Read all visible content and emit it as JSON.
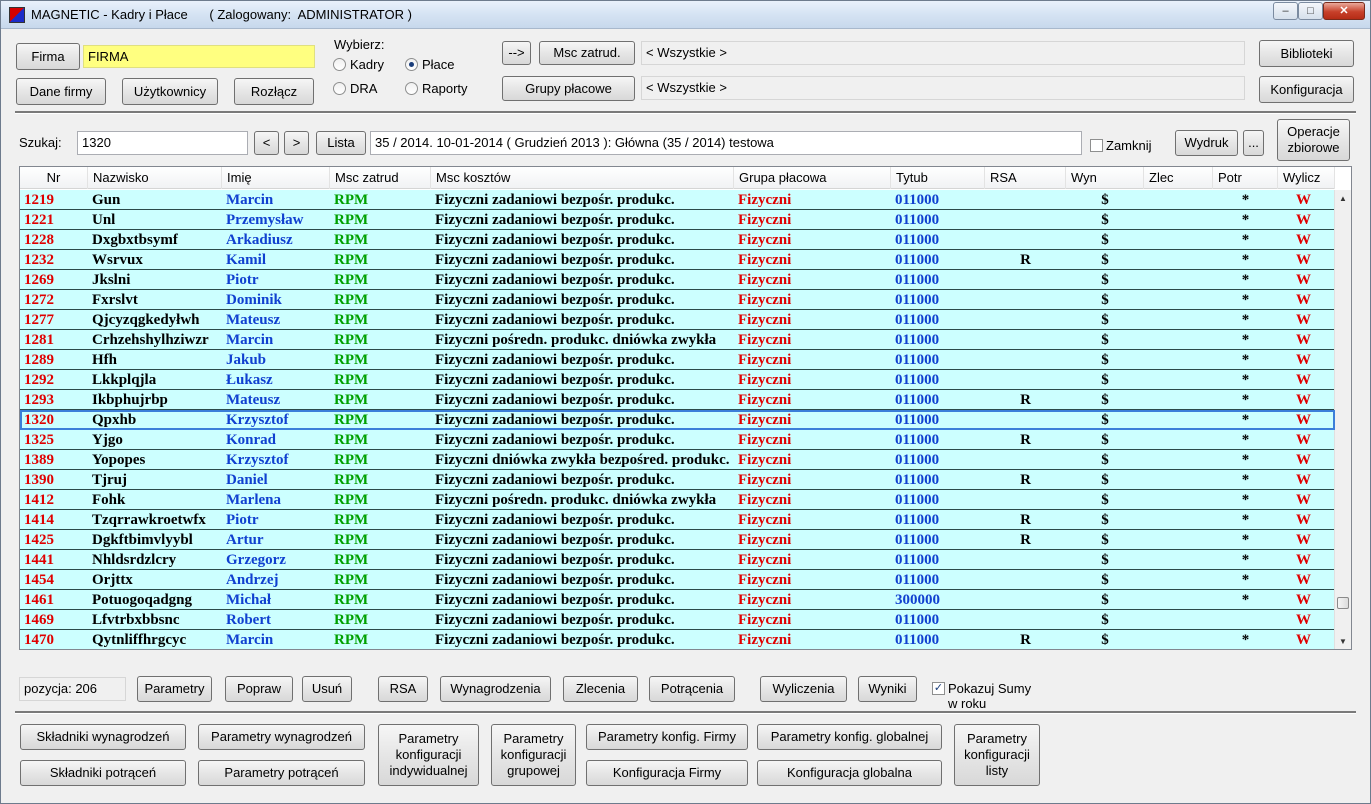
{
  "titlebar": {
    "title": "MAGNETIC - Kadry i Płace      ( Zalogowany:  ADMINISTRATOR )",
    "minimize": "‒",
    "maximize": "□",
    "close": "✕"
  },
  "top": {
    "firma_button": "Firma",
    "firma_value": "FIRMA",
    "dane_firmy": "Dane firmy",
    "uzytkownicy": "Użytkownicy",
    "rozlacz": "Rozłącz",
    "wybierz_label": "Wybierz:",
    "radios": {
      "kadry": "Kadry",
      "place": "Płace",
      "dra": "DRA",
      "raporty": "Raporty"
    },
    "selected_radio": "place",
    "arrow_button": "-->",
    "msc_zatrud_button": "Msc zatrud.",
    "msc_zatrud_value": "< Wszystkie >",
    "grupy_placowe_button": "Grupy płacowe",
    "grupy_placowe_value": "< Wszystkie >",
    "biblioteki": "Biblioteki",
    "konfiguracja": "Konfiguracja"
  },
  "search": {
    "label": "Szukaj:",
    "value": "1320",
    "prev": "<",
    "next": ">",
    "lista": "Lista",
    "period": "35 / 2014.  10-01-2014  ( Grudzień 2013 ): Główna (35 / 2014) testowa",
    "zamknij": "Zamknij",
    "wydruk": "Wydruk",
    "more": "...",
    "operacje": "Operacje zbiorowe"
  },
  "grid": {
    "columns": [
      "Nr",
      "Nazwisko",
      "Imię",
      "Msc zatrud",
      "Msc kosztów",
      "Grupa płacowa",
      "Tytub",
      "RSA",
      "Wyn",
      "Zlec",
      "Potr",
      "Wylicz"
    ],
    "selected_nr": "1320",
    "rows": [
      {
        "nr": "1219",
        "nazwisko": "Gun",
        "imie": "Marcin",
        "msc": "RPM",
        "koszt": "Fizyczni zadaniowi bezpośr. produkc.",
        "grupa": "Fizyczni",
        "tytub": "011000",
        "rsa": "",
        "wyn": "$",
        "zlec": "",
        "potr": "*",
        "wylicz": "W"
      },
      {
        "nr": "1221",
        "nazwisko": "Unl",
        "imie": "Przemysław",
        "msc": "RPM",
        "koszt": "Fizyczni zadaniowi bezpośr. produkc.",
        "grupa": "Fizyczni",
        "tytub": "011000",
        "rsa": "",
        "wyn": "$",
        "zlec": "",
        "potr": "*",
        "wylicz": "W"
      },
      {
        "nr": "1228",
        "nazwisko": "Dxgbxtbsymf",
        "imie": "Arkadiusz",
        "msc": "RPM",
        "koszt": "Fizyczni zadaniowi bezpośr. produkc.",
        "grupa": "Fizyczni",
        "tytub": "011000",
        "rsa": "",
        "wyn": "$",
        "zlec": "",
        "potr": "*",
        "wylicz": "W"
      },
      {
        "nr": "1232",
        "nazwisko": "Wsrvux",
        "imie": "Kamil",
        "msc": "RPM",
        "koszt": "Fizyczni zadaniowi bezpośr. produkc.",
        "grupa": "Fizyczni",
        "tytub": "011000",
        "rsa": "R",
        "wyn": "$",
        "zlec": "",
        "potr": "*",
        "wylicz": "W"
      },
      {
        "nr": "1269",
        "nazwisko": "Jkslni",
        "imie": "Piotr",
        "msc": "RPM",
        "koszt": "Fizyczni zadaniowi bezpośr. produkc.",
        "grupa": "Fizyczni",
        "tytub": "011000",
        "rsa": "",
        "wyn": "$",
        "zlec": "",
        "potr": "*",
        "wylicz": "W"
      },
      {
        "nr": "1272",
        "nazwisko": "Fxrslvt",
        "imie": "Dominik",
        "msc": "RPM",
        "koszt": "Fizyczni zadaniowi bezpośr. produkc.",
        "grupa": "Fizyczni",
        "tytub": "011000",
        "rsa": "",
        "wyn": "$",
        "zlec": "",
        "potr": "*",
        "wylicz": "W"
      },
      {
        "nr": "1277",
        "nazwisko": "Qjcyzqgkedyłwh",
        "imie": "Mateusz",
        "msc": "RPM",
        "koszt": "Fizyczni zadaniowi bezpośr. produkc.",
        "grupa": "Fizyczni",
        "tytub": "011000",
        "rsa": "",
        "wyn": "$",
        "zlec": "",
        "potr": "*",
        "wylicz": "W"
      },
      {
        "nr": "1281",
        "nazwisko": "Crhzehshylhziwzr",
        "imie": "Marcin",
        "msc": "RPM",
        "koszt": "Fizyczni pośredn. produkc. dniówka zwykła",
        "grupa": "Fizyczni",
        "tytub": "011000",
        "rsa": "",
        "wyn": "$",
        "zlec": "",
        "potr": "*",
        "wylicz": "W"
      },
      {
        "nr": "1289",
        "nazwisko": "Hfh",
        "imie": "Jakub",
        "msc": "RPM",
        "koszt": "Fizyczni zadaniowi bezpośr. produkc.",
        "grupa": "Fizyczni",
        "tytub": "011000",
        "rsa": "",
        "wyn": "$",
        "zlec": "",
        "potr": "*",
        "wylicz": "W"
      },
      {
        "nr": "1292",
        "nazwisko": "Lkkplqjla",
        "imie": "Łukasz",
        "msc": "RPM",
        "koszt": "Fizyczni zadaniowi bezpośr. produkc.",
        "grupa": "Fizyczni",
        "tytub": "011000",
        "rsa": "",
        "wyn": "$",
        "zlec": "",
        "potr": "*",
        "wylicz": "W"
      },
      {
        "nr": "1293",
        "nazwisko": "Ikbphujrbp",
        "imie": "Mateusz",
        "msc": "RPM",
        "koszt": "Fizyczni zadaniowi bezpośr. produkc.",
        "grupa": "Fizyczni",
        "tytub": "011000",
        "rsa": "R",
        "wyn": "$",
        "zlec": "",
        "potr": "*",
        "wylicz": "W"
      },
      {
        "nr": "1320",
        "nazwisko": "Qpxhb",
        "imie": "Krzysztof",
        "msc": "RPM",
        "koszt": "Fizyczni zadaniowi bezpośr. produkc.",
        "grupa": "Fizyczni",
        "tytub": "011000",
        "rsa": "",
        "wyn": "$",
        "zlec": "",
        "potr": "*",
        "wylicz": "W"
      },
      {
        "nr": "1325",
        "nazwisko": "Yjgo",
        "imie": "Konrad",
        "msc": "RPM",
        "koszt": "Fizyczni zadaniowi bezpośr. produkc.",
        "grupa": "Fizyczni",
        "tytub": "011000",
        "rsa": "R",
        "wyn": "$",
        "zlec": "",
        "potr": "*",
        "wylicz": "W"
      },
      {
        "nr": "1389",
        "nazwisko": "Yopopes",
        "imie": "Krzysztof",
        "msc": "RPM",
        "koszt": "Fizyczni dniówka zwykła bezpośred. produkc.",
        "grupa": "Fizyczni",
        "tytub": "011000",
        "rsa": "",
        "wyn": "$",
        "zlec": "",
        "potr": "*",
        "wylicz": "W"
      },
      {
        "nr": "1390",
        "nazwisko": "Tjruj",
        "imie": "Daniel",
        "msc": "RPM",
        "koszt": "Fizyczni zadaniowi bezpośr. produkc.",
        "grupa": "Fizyczni",
        "tytub": "011000",
        "rsa": "R",
        "wyn": "$",
        "zlec": "",
        "potr": "*",
        "wylicz": "W"
      },
      {
        "nr": "1412",
        "nazwisko": "Fohk",
        "imie": "Marlena",
        "msc": "RPM",
        "koszt": "Fizyczni pośredn. produkc. dniówka zwykła",
        "grupa": "Fizyczni",
        "tytub": "011000",
        "rsa": "",
        "wyn": "$",
        "zlec": "",
        "potr": "*",
        "wylicz": "W"
      },
      {
        "nr": "1414",
        "nazwisko": "Tzqrrawkroetwfx",
        "imie": "Piotr",
        "msc": "RPM",
        "koszt": "Fizyczni zadaniowi bezpośr. produkc.",
        "grupa": "Fizyczni",
        "tytub": "011000",
        "rsa": "R",
        "wyn": "$",
        "zlec": "",
        "potr": "*",
        "wylicz": "W"
      },
      {
        "nr": "1425",
        "nazwisko": "Dgkftbimvlyybl",
        "imie": "Artur",
        "msc": "RPM",
        "koszt": "Fizyczni zadaniowi bezpośr. produkc.",
        "grupa": "Fizyczni",
        "tytub": "011000",
        "rsa": "R",
        "wyn": "$",
        "zlec": "",
        "potr": "*",
        "wylicz": "W"
      },
      {
        "nr": "1441",
        "nazwisko": "Nhldsrdzlcry",
        "imie": "Grzegorz",
        "msc": "RPM",
        "koszt": "Fizyczni zadaniowi bezpośr. produkc.",
        "grupa": "Fizyczni",
        "tytub": "011000",
        "rsa": "",
        "wyn": "$",
        "zlec": "",
        "potr": "*",
        "wylicz": "W"
      },
      {
        "nr": "1454",
        "nazwisko": "Orjttx",
        "imie": "Andrzej",
        "msc": "RPM",
        "koszt": "Fizyczni zadaniowi bezpośr. produkc.",
        "grupa": "Fizyczni",
        "tytub": "011000",
        "rsa": "",
        "wyn": "$",
        "zlec": "",
        "potr": "*",
        "wylicz": "W"
      },
      {
        "nr": "1461",
        "nazwisko": "Potuogoqadgng",
        "imie": "Michał",
        "msc": "RPM",
        "koszt": "Fizyczni zadaniowi bezpośr. produkc.",
        "grupa": "Fizyczni",
        "tytub": "300000",
        "rsa": "",
        "wyn": "$",
        "zlec": "",
        "potr": "*",
        "wylicz": "W"
      },
      {
        "nr": "1469",
        "nazwisko": "Lfvtrbxbbsnc",
        "imie": "Robert",
        "msc": "RPM",
        "koszt": "Fizyczni zadaniowi bezpośr. produkc.",
        "grupa": "Fizyczni",
        "tytub": "011000",
        "rsa": "",
        "wyn": "$",
        "zlec": "",
        "potr": "",
        "wylicz": "W"
      },
      {
        "nr": "1470",
        "nazwisko": "Qytnliffhrgcyc",
        "imie": "Marcin",
        "msc": "RPM",
        "koszt": "Fizyczni zadaniowi bezpośr. produkc.",
        "grupa": "Fizyczni",
        "tytub": "011000",
        "rsa": "R",
        "wyn": "$",
        "zlec": "",
        "potr": "*",
        "wylicz": "W"
      }
    ]
  },
  "actions": {
    "pozycja_label": "pozycja:",
    "pozycja_value": "206",
    "parametry": "Parametry",
    "popraw": "Popraw",
    "usun": "Usuń",
    "rsa": "RSA",
    "wynagrodzenia": "Wynagrodzenia",
    "zlecenia": "Zlecenia",
    "potracenia": "Potrącenia",
    "wyliczenia": "Wyliczenia",
    "wyniki": "Wyniki",
    "pokazuj_sumy_line1": "Pokazuj Sumy",
    "pokazuj_sumy_line2": "w roku"
  },
  "bottom": {
    "skladniki_wynagrodzen": "Składniki wynagrodzeń",
    "skladniki_potracen": "Składniki potrąceń",
    "parametry_wynagrodzen": "Parametry wynagrodzeń",
    "parametry_potracen": "Parametry potrąceń",
    "param_konf_indywidualnej_1": "Parametry",
    "param_konf_indywidualnej_2": "konfiguracji",
    "param_konf_indywidualnej_3": "indywidualnej",
    "param_konf_grupowej_1": "Parametry",
    "param_konf_grupowej_2": "konfiguracji",
    "param_konf_grupowej_3": "grupowej",
    "parametry_konfig_firmy": "Parametry konfig. Firmy",
    "konfiguracja_firmy": "Konfiguracja Firmy",
    "parametry_konfig_globalnej": "Parametry konfig. globalnej",
    "konfiguracja_globalna": "Konfiguracja globalna",
    "param_konf_listy_1": "Parametry",
    "param_konf_listy_2": "konfiguracji",
    "param_konf_listy_3": "listy"
  },
  "colors": {
    "row_bg": "#ccffff",
    "nr": "#e00000",
    "imie": "#1040d0",
    "msc": "#00a000",
    "grupa": "#e00000",
    "firma_field": "#ffff80"
  }
}
